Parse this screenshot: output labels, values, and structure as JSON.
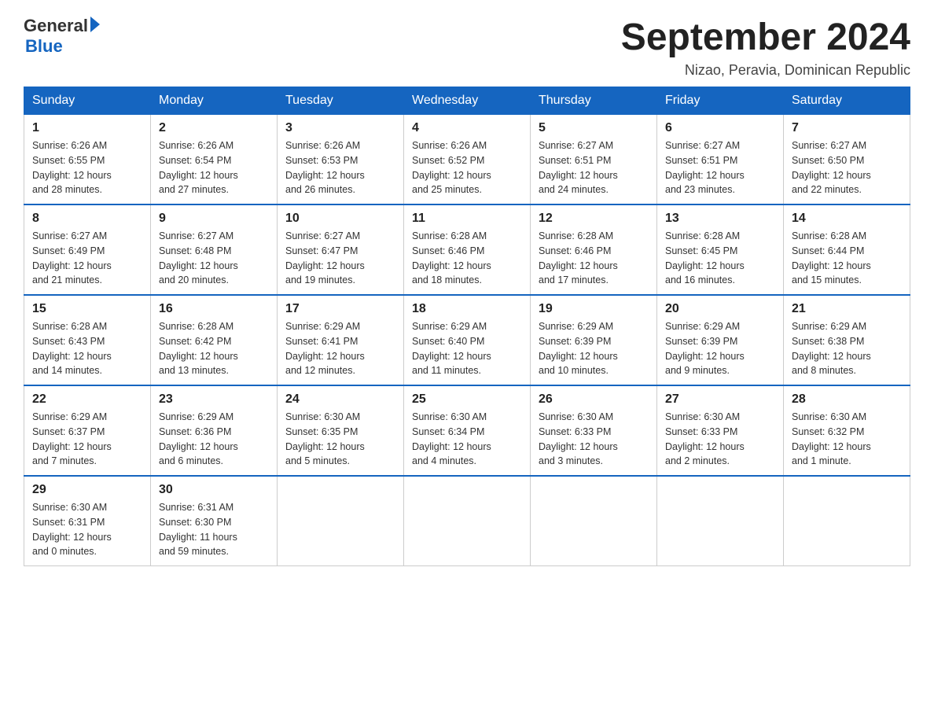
{
  "logo": {
    "general": "General",
    "arrow": "▶",
    "blue": "Blue"
  },
  "title": "September 2024",
  "location": "Nizao, Peravia, Dominican Republic",
  "days_of_week": [
    "Sunday",
    "Monday",
    "Tuesday",
    "Wednesday",
    "Thursday",
    "Friday",
    "Saturday"
  ],
  "weeks": [
    [
      {
        "day": "1",
        "sunrise": "6:26 AM",
        "sunset": "6:55 PM",
        "daylight": "12 hours and 28 minutes."
      },
      {
        "day": "2",
        "sunrise": "6:26 AM",
        "sunset": "6:54 PM",
        "daylight": "12 hours and 27 minutes."
      },
      {
        "day": "3",
        "sunrise": "6:26 AM",
        "sunset": "6:53 PM",
        "daylight": "12 hours and 26 minutes."
      },
      {
        "day": "4",
        "sunrise": "6:26 AM",
        "sunset": "6:52 PM",
        "daylight": "12 hours and 25 minutes."
      },
      {
        "day": "5",
        "sunrise": "6:27 AM",
        "sunset": "6:51 PM",
        "daylight": "12 hours and 24 minutes."
      },
      {
        "day": "6",
        "sunrise": "6:27 AM",
        "sunset": "6:51 PM",
        "daylight": "12 hours and 23 minutes."
      },
      {
        "day": "7",
        "sunrise": "6:27 AM",
        "sunset": "6:50 PM",
        "daylight": "12 hours and 22 minutes."
      }
    ],
    [
      {
        "day": "8",
        "sunrise": "6:27 AM",
        "sunset": "6:49 PM",
        "daylight": "12 hours and 21 minutes."
      },
      {
        "day": "9",
        "sunrise": "6:27 AM",
        "sunset": "6:48 PM",
        "daylight": "12 hours and 20 minutes."
      },
      {
        "day": "10",
        "sunrise": "6:27 AM",
        "sunset": "6:47 PM",
        "daylight": "12 hours and 19 minutes."
      },
      {
        "day": "11",
        "sunrise": "6:28 AM",
        "sunset": "6:46 PM",
        "daylight": "12 hours and 18 minutes."
      },
      {
        "day": "12",
        "sunrise": "6:28 AM",
        "sunset": "6:46 PM",
        "daylight": "12 hours and 17 minutes."
      },
      {
        "day": "13",
        "sunrise": "6:28 AM",
        "sunset": "6:45 PM",
        "daylight": "12 hours and 16 minutes."
      },
      {
        "day": "14",
        "sunrise": "6:28 AM",
        "sunset": "6:44 PM",
        "daylight": "12 hours and 15 minutes."
      }
    ],
    [
      {
        "day": "15",
        "sunrise": "6:28 AM",
        "sunset": "6:43 PM",
        "daylight": "12 hours and 14 minutes."
      },
      {
        "day": "16",
        "sunrise": "6:28 AM",
        "sunset": "6:42 PM",
        "daylight": "12 hours and 13 minutes."
      },
      {
        "day": "17",
        "sunrise": "6:29 AM",
        "sunset": "6:41 PM",
        "daylight": "12 hours and 12 minutes."
      },
      {
        "day": "18",
        "sunrise": "6:29 AM",
        "sunset": "6:40 PM",
        "daylight": "12 hours and 11 minutes."
      },
      {
        "day": "19",
        "sunrise": "6:29 AM",
        "sunset": "6:39 PM",
        "daylight": "12 hours and 10 minutes."
      },
      {
        "day": "20",
        "sunrise": "6:29 AM",
        "sunset": "6:39 PM",
        "daylight": "12 hours and 9 minutes."
      },
      {
        "day": "21",
        "sunrise": "6:29 AM",
        "sunset": "6:38 PM",
        "daylight": "12 hours and 8 minutes."
      }
    ],
    [
      {
        "day": "22",
        "sunrise": "6:29 AM",
        "sunset": "6:37 PM",
        "daylight": "12 hours and 7 minutes."
      },
      {
        "day": "23",
        "sunrise": "6:29 AM",
        "sunset": "6:36 PM",
        "daylight": "12 hours and 6 minutes."
      },
      {
        "day": "24",
        "sunrise": "6:30 AM",
        "sunset": "6:35 PM",
        "daylight": "12 hours and 5 minutes."
      },
      {
        "day": "25",
        "sunrise": "6:30 AM",
        "sunset": "6:34 PM",
        "daylight": "12 hours and 4 minutes."
      },
      {
        "day": "26",
        "sunrise": "6:30 AM",
        "sunset": "6:33 PM",
        "daylight": "12 hours and 3 minutes."
      },
      {
        "day": "27",
        "sunrise": "6:30 AM",
        "sunset": "6:33 PM",
        "daylight": "12 hours and 2 minutes."
      },
      {
        "day": "28",
        "sunrise": "6:30 AM",
        "sunset": "6:32 PM",
        "daylight": "12 hours and 1 minute."
      }
    ],
    [
      {
        "day": "29",
        "sunrise": "6:30 AM",
        "sunset": "6:31 PM",
        "daylight": "12 hours and 0 minutes."
      },
      {
        "day": "30",
        "sunrise": "6:31 AM",
        "sunset": "6:30 PM",
        "daylight": "11 hours and 59 minutes."
      },
      null,
      null,
      null,
      null,
      null
    ]
  ],
  "labels": {
    "sunrise": "Sunrise:",
    "sunset": "Sunset:",
    "daylight": "Daylight:"
  }
}
